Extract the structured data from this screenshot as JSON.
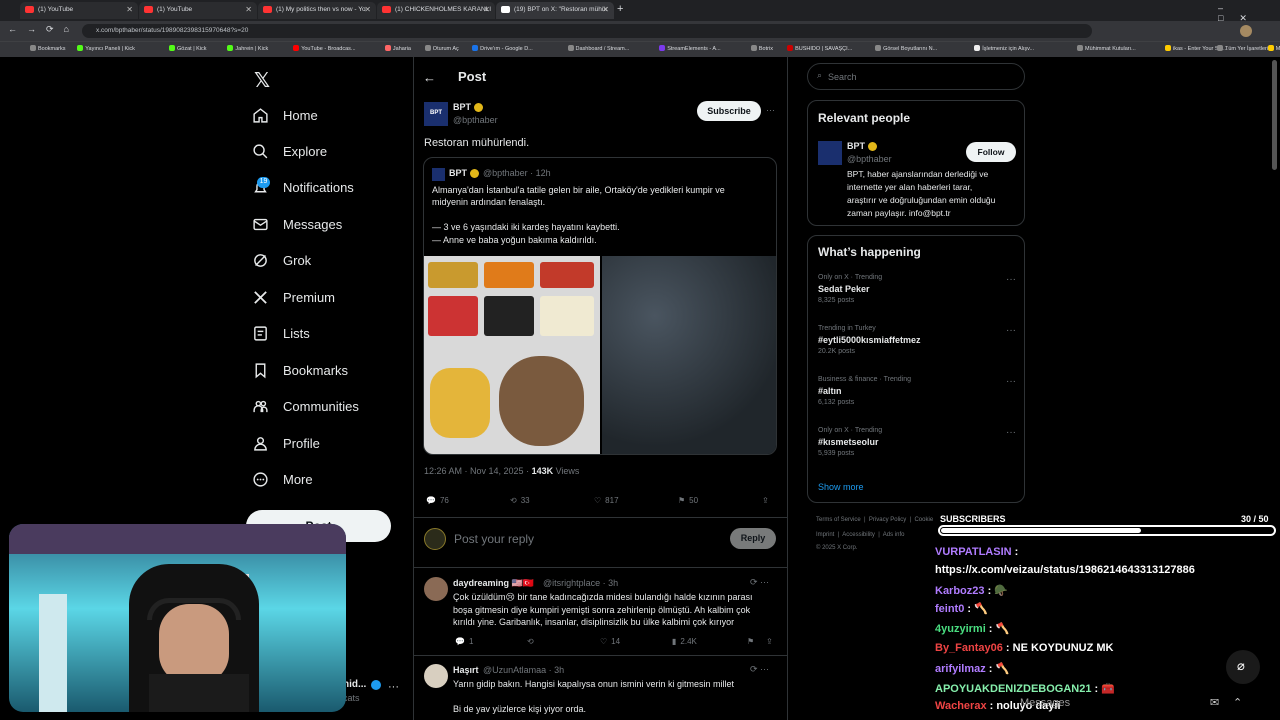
{
  "browser": {
    "tabs": [
      {
        "label": "(1) YouTube"
      },
      {
        "label": "(1) YouTube"
      },
      {
        "label": "(1) My politics then vs now - Yo"
      },
      {
        "label": "(1) CHICKENHOLMES KARANLI"
      },
      {
        "label": "(19) BPT on X: \"Restoran mühür"
      }
    ],
    "url": "x.com/bpthaber/status/1989082398315970648?s=20",
    "bookmarks": [
      "Bookmarks",
      "Yayıncı Paneli | Kick",
      "Gözat | Kick",
      "Jahrein | Kick",
      "YouTube - Broadcas...",
      "Jaharia",
      "Oturum Aç",
      "Drive'ım - Google D...",
      "Dashboard / Stream...",
      "StreamElements - A...",
      "Botrix",
      "BUSHIDO | SAVAŞÇI...",
      "Görsel Boyutlarını N...",
      "İşletmeniz için Alışv...",
      "Mühimmat Kutuları...",
      "ikas - Enter Your Sto...",
      "My Invoices - Invoic...",
      "Tüm Yer İşaretleri"
    ]
  },
  "sidebar": {
    "notif_badge": "19",
    "items": [
      {
        "label": "Home",
        "icon": "home-icon"
      },
      {
        "label": "Explore",
        "icon": "search-icon"
      },
      {
        "label": "Notifications",
        "icon": "bell-icon"
      },
      {
        "label": "Messages",
        "icon": "mail-icon"
      },
      {
        "label": "Grok",
        "icon": "grok-icon"
      },
      {
        "label": "Premium",
        "icon": "x-logo-icon"
      },
      {
        "label": "Lists",
        "icon": "list-icon"
      },
      {
        "label": "Bookmarks",
        "icon": "bookmark-icon"
      },
      {
        "label": "Communities",
        "icon": "people-icon"
      },
      {
        "label": "Profile",
        "icon": "person-icon"
      },
      {
        "label": "More",
        "icon": "more-circle-icon"
      }
    ],
    "post_label": "Post",
    "account_name": "hid...",
    "account_handle": "cats"
  },
  "post": {
    "header": "Post",
    "author": "BPT",
    "handle": "@bpthaber",
    "subscribe": "Subscribe",
    "text": "Restoran mühürlendi.",
    "quote": {
      "author": "BPT",
      "handle": "@bpthaber · 12h",
      "line1": "Almanya'dan İstanbul'a tatile gelen bir aile, Ortaköy'de yedikleri kumpir ve",
      "line2": "midyenin ardından fenalaştı.",
      "line3": "— 3 ve 6 yaşındaki iki kardeş hayatını kaybetti.",
      "line4": "— Anne ve baba yoğun bakıma kaldırıldı."
    },
    "timestamp": "12:26 AM · Nov 14, 2025 · ",
    "views_count": "143K",
    "views_label": " Views",
    "replies": "76",
    "reposts": "33",
    "likes": "817",
    "bookmarks": "50",
    "reply_placeholder": "Post your reply",
    "reply_button": "Reply"
  },
  "replies": [
    {
      "name": "daydreaming 🇺🇸🇹🇷",
      "handle": "@itsrightplace · 3h",
      "text1": "Çok üzüldüm😢 bir tane kadıncağızda midesi bulandığı halde kızının parası",
      "text2": "boşa gitmesin diye kumpiri yemişti sonra zehirlenip ölmüştü. Ah kalbim çok",
      "text3": "kırıldı yine. Garibanlık, insanlar, disiplinsizlik bu ülke kalbimi çok kırıyor",
      "replies": "1",
      "likes": "14",
      "views": "2.4K"
    },
    {
      "name": "Haşırt",
      "handle": "@UzunAtlamaa · 3h",
      "text1": "Yarın gidip bakın. Hangisi kapalıysa onun ismini verin ki gitmesin millet",
      "text2": "Bi de yav yüzlerce kişi yiyor orda."
    }
  ],
  "right": {
    "search_placeholder": "Search",
    "relevant_title": "Relevant people",
    "person_name": "BPT",
    "person_handle": "@bpthaber",
    "follow": "Follow",
    "bio1": "BPT, haber ajanslarından derlediği ve",
    "bio2": "internette yer alan haberleri tarar,",
    "bio3": "araştırır ve doğruluğundan emin olduğu",
    "bio4": "zaman paylaşır. info@bpt.tr",
    "happening_title": "What’s happening",
    "trends": [
      {
        "cat": "Only on X · Trending",
        "name": "Sedat Peker",
        "count": "8,325 posts"
      },
      {
        "cat": "Trending in Turkey",
        "name": "#eytli5000kısmiaffetmez",
        "count": "20.2K posts"
      },
      {
        "cat": "Business & finance · Trending",
        "name": "#altın",
        "count": "6,132 posts"
      },
      {
        "cat": "Only on X · Trending",
        "name": "#kısmetseolur",
        "count": "5,939 posts"
      }
    ],
    "show_more": "Show more",
    "footer1": "Terms of Service  |  Privacy Policy  |  Cookie",
    "footer2": "Imprint  |  Accessibility  |  Ads info",
    "footer3": "© 2025 X Corp."
  },
  "overlay": {
    "subs_title": "SUBSCRIBERS",
    "subs_count": "30 / 50",
    "subs_fraction": 0.6,
    "messages_label": "Messages",
    "chat": [
      {
        "user": "VURPATLASIN",
        "color": "#b07cff",
        "msg": " :"
      },
      {
        "user": "",
        "color": "#fff",
        "msg": "https://x.com/veizau/status/1986214643313127886"
      },
      {
        "user": "Karboz23",
        "color": "#b07cff",
        "msg": " : 🪖"
      },
      {
        "user": "feint0",
        "color": "#b07cff",
        "msg": " : 🪓"
      },
      {
        "user": "4yuzyirmi",
        "color": "#4ade80",
        "msg": " : 🪓"
      },
      {
        "user": "By_Fantay06",
        "color": "#ef4444",
        "msg": " : NE KOYDUNUZ MK"
      },
      {
        "user": "arifyilmaz",
        "color": "#b07cff",
        "msg": " : 🪓"
      },
      {
        "user": "APOYUAKDENIZDEBOGAN21",
        "color": "#86efac",
        "msg": " : 🧰"
      },
      {
        "user": "Wacherax",
        "color": "#ef4444",
        "msg": " : noluyo dayii"
      }
    ]
  }
}
